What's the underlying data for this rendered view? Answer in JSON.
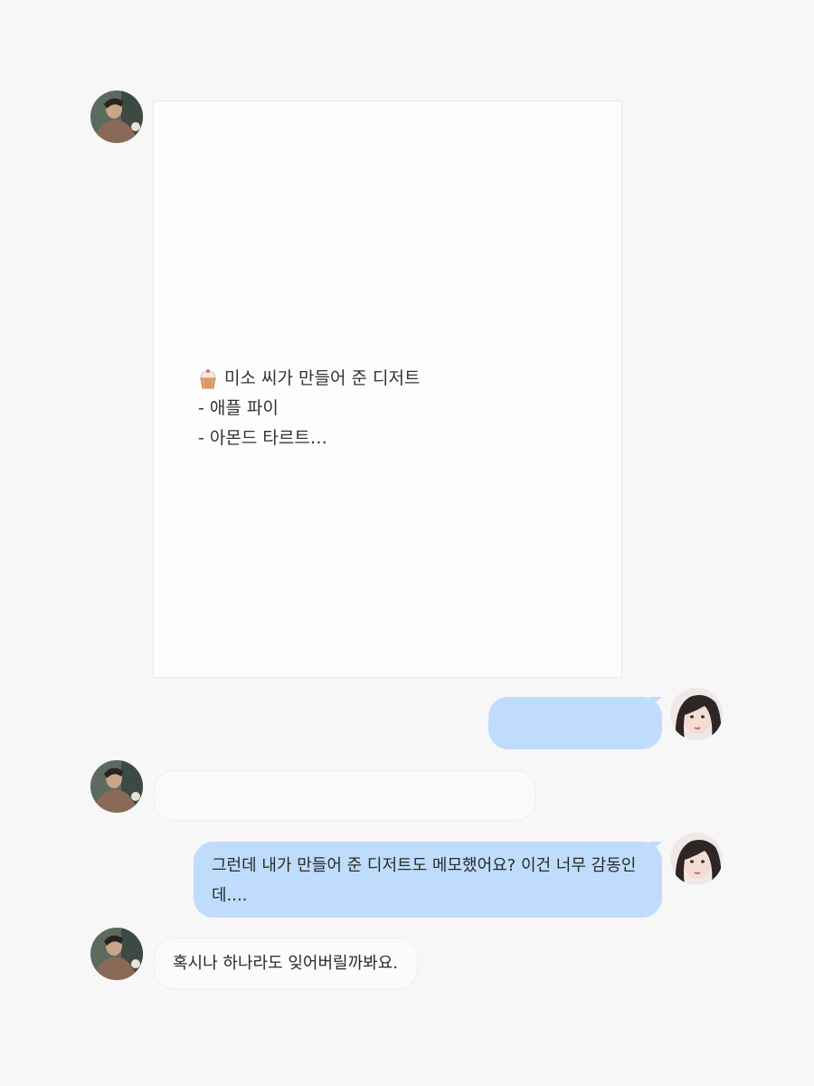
{
  "memo": {
    "title_icon": "cupcake-icon",
    "lines": [
      "미소 씨가 만들어 준 디저트",
      "- 애플 파이",
      "- 아몬드 타르트…"
    ]
  },
  "messages": [
    {
      "sender": "partner",
      "avatar": "partner-avatar",
      "text": ""
    },
    {
      "sender": "me",
      "avatar": "my-avatar",
      "text": ""
    },
    {
      "sender": "partner",
      "avatar": "partner-avatar",
      "text": ""
    },
    {
      "sender": "me",
      "avatar": "my-avatar",
      "text": "그런데 내가 만들어 준 디저트도 메모했어요? 이건 너무 감동인데...."
    },
    {
      "sender": "partner",
      "avatar": "partner-avatar",
      "text": "혹시나 하나라도 잊어버릴까봐요."
    }
  ],
  "colors": {
    "background": "#f7f7f8",
    "my_bubble": "#bfdcfc",
    "partner_bubble": "#fbfbfc",
    "memo_card": "#fdfdfd"
  }
}
